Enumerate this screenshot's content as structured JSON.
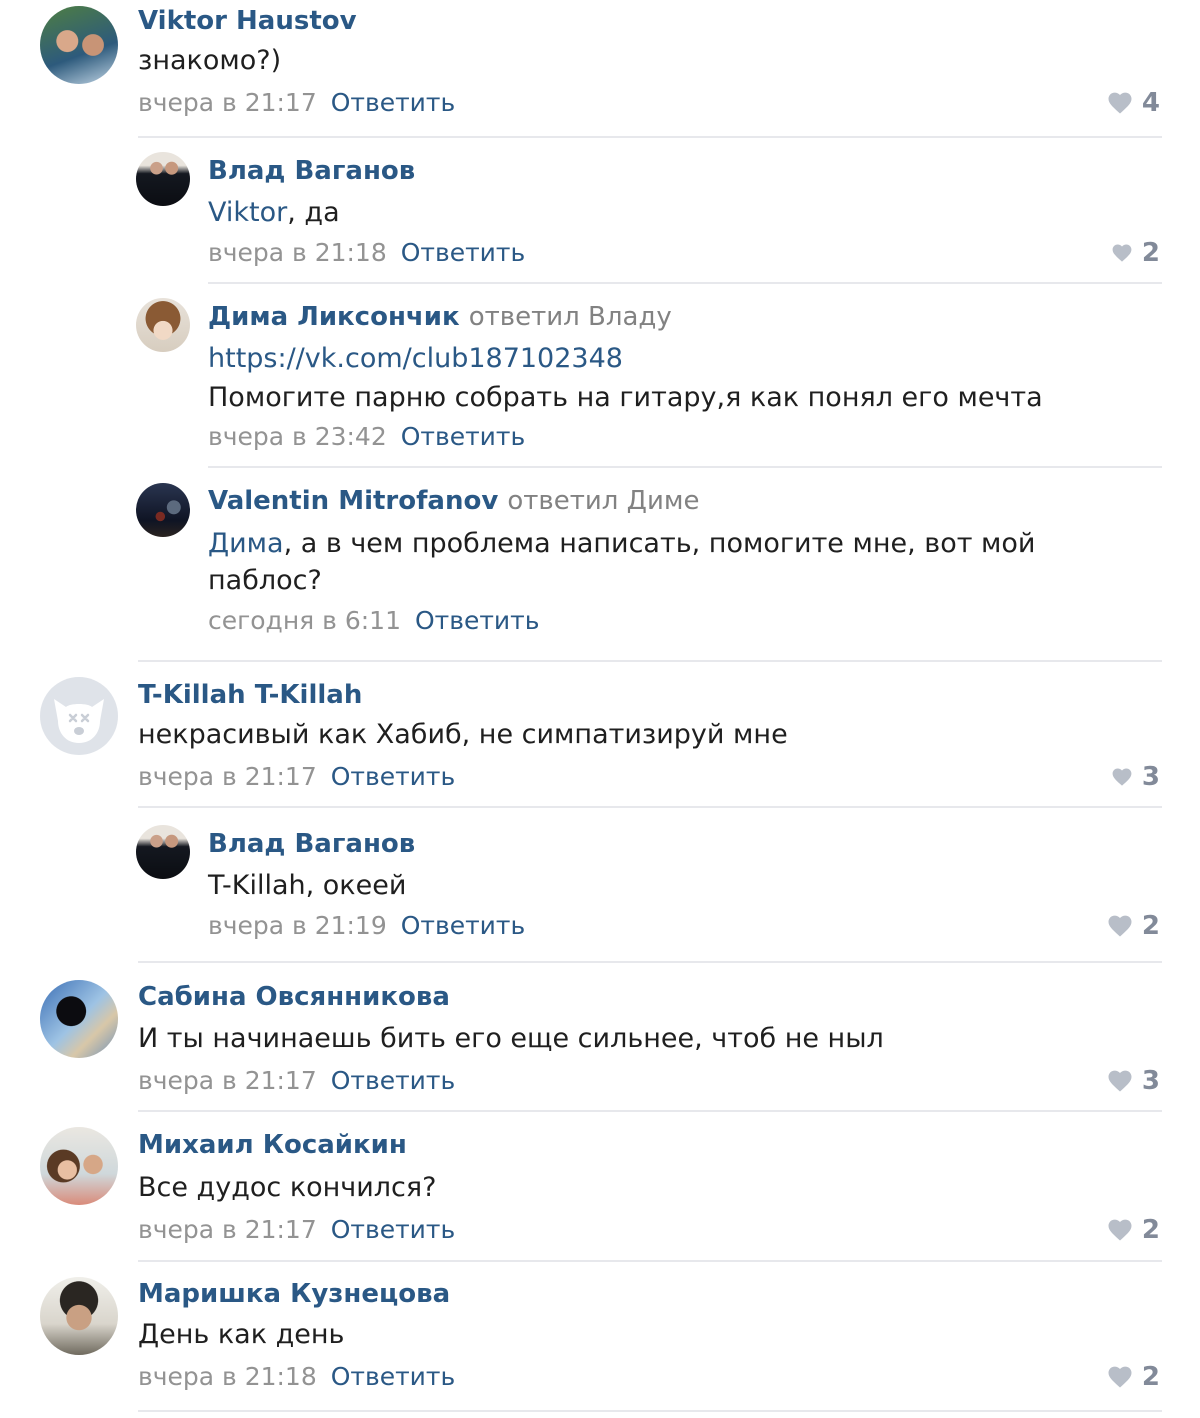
{
  "comments": [
    {
      "author": "Viktor Haustov",
      "text": "знакомо?)",
      "time": "вчера в 21:17",
      "reply": "Ответить",
      "likes": "4"
    },
    {
      "author": "Влад Ваганов",
      "mention": "Viktor",
      "text": ", да",
      "time": "вчера в 21:18",
      "reply": "Ответить",
      "likes": "2"
    },
    {
      "author": "Дима Ликсончик",
      "replied_to": "ответил Владу",
      "link": "https://vk.com/club187102348",
      "text": "Помогите парню собрать на гитару,я как понял его мечта",
      "time": "вчера в 23:42",
      "reply": "Ответить"
    },
    {
      "author": "Valentin Mitrofanov",
      "replied_to": "ответил Диме",
      "mention": "Дима",
      "text_line1": ", а в чем проблема написать, помогите мне, вот мой",
      "text_line2": "паблос?",
      "time": "сегодня в 6:11",
      "reply": "Ответить"
    },
    {
      "author": "T-Killah T-Killah",
      "text": "некрасивый как Хабиб, не симпатизируй мне",
      "time": "вчера в 21:17",
      "reply": "Ответить",
      "likes": "3"
    },
    {
      "author": "Влад Ваганов",
      "mention": "T-Killah",
      "text": ", океей",
      "time": "вчера в 21:19",
      "reply": "Ответить",
      "likes": "2"
    },
    {
      "author": "Сабина Овсянникова",
      "text": "И ты начинаешь бить его еще сильнее, чтоб не ныл",
      "time": "вчера в 21:17",
      "reply": "Ответить",
      "likes": "3"
    },
    {
      "author": "Михаил Косайкин",
      "text": "Все дудос кончился?",
      "time": "вчера в 21:17",
      "reply": "Ответить",
      "likes": "2"
    },
    {
      "author": "Маришка Кузнецова",
      "text": "День как день",
      "time": "вчера в 21:18",
      "reply": "Ответить",
      "likes": "2"
    }
  ],
  "colors": {
    "link": "#2a5885",
    "meta": "#939393",
    "divider": "#e7e8ec",
    "like": "#828a99"
  }
}
